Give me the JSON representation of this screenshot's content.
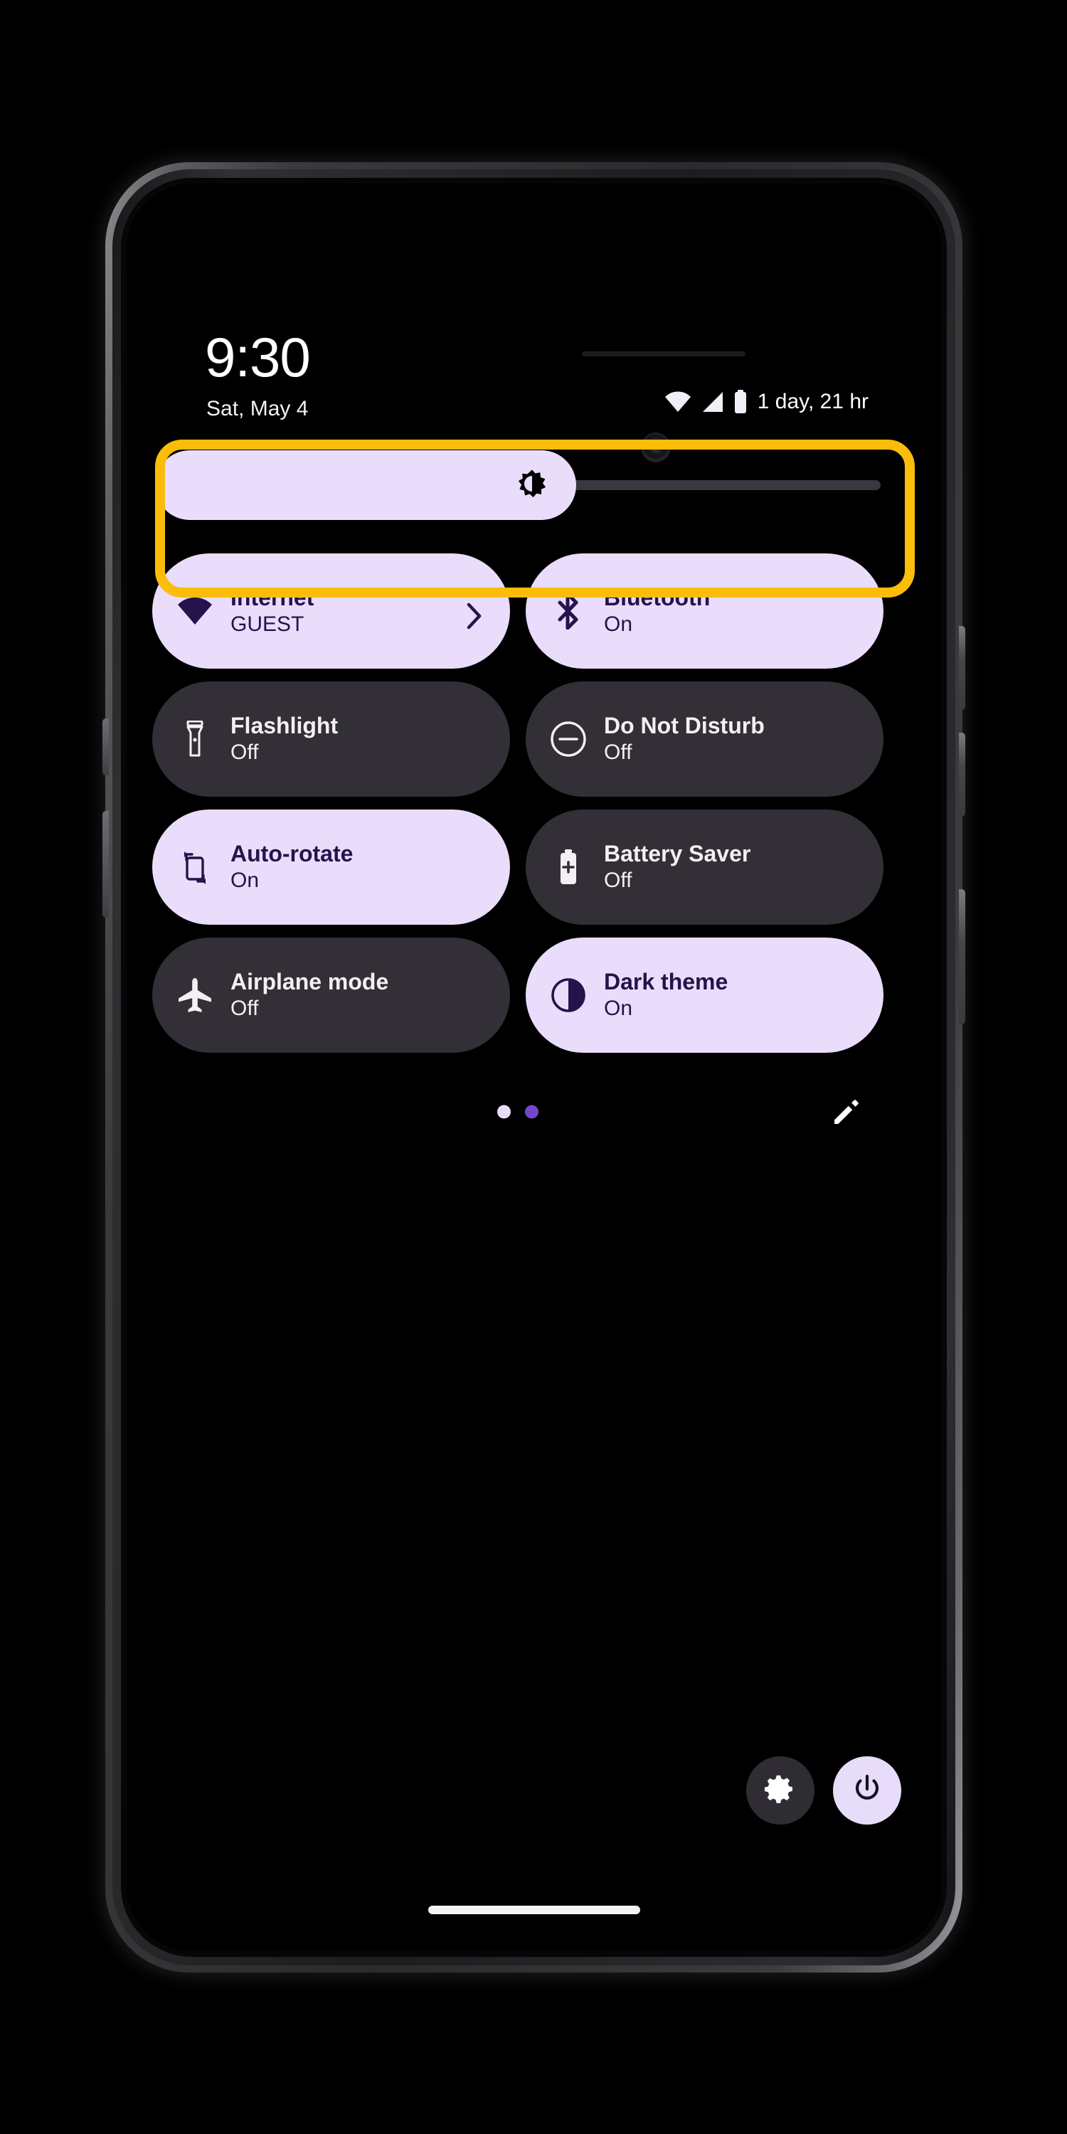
{
  "statusbar": {
    "clock": "9:30",
    "date": "Sat, May 4",
    "battery_estimate": "1 day, 21 hr",
    "icons": [
      "wifi-icon",
      "cellular-signal-icon",
      "battery-icon"
    ]
  },
  "brightness": {
    "name": "brightness-slider",
    "icon": "brightness-icon",
    "value_percent": 58,
    "fill_color": "#E9DDFB",
    "track_color": "#3A373E"
  },
  "highlight": {
    "target": "brightness-slider",
    "color": "#FBBC0A"
  },
  "tiles": [
    {
      "label": "Internet",
      "state": "GUEST",
      "icon": "wifi-icon",
      "active": true,
      "chevron": true
    },
    {
      "label": "Bluetooth",
      "state": "On",
      "icon": "bluetooth-icon",
      "active": true,
      "chevron": false
    },
    {
      "label": "Flashlight",
      "state": "Off",
      "icon": "flashlight-icon",
      "active": false,
      "chevron": false
    },
    {
      "label": "Do Not Disturb",
      "state": "Off",
      "icon": "do-not-disturb-icon",
      "active": false,
      "chevron": false
    },
    {
      "label": "Auto-rotate",
      "state": "On",
      "icon": "auto-rotate-icon",
      "active": true,
      "chevron": false
    },
    {
      "label": "Battery Saver",
      "state": "Off",
      "icon": "battery-saver-icon",
      "active": false,
      "chevron": false
    },
    {
      "label": "Airplane mode",
      "state": "Off",
      "icon": "airplane-icon",
      "active": false,
      "chevron": false
    },
    {
      "label": "Dark theme",
      "state": "On",
      "icon": "dark-theme-icon",
      "active": true,
      "chevron": false
    }
  ],
  "footer": {
    "pages": [
      {
        "name": "page-dot-1",
        "active": false
      },
      {
        "name": "page-dot-2",
        "active": true
      }
    ],
    "edit_icon": "pencil-edit-icon"
  },
  "bottom_actions": [
    {
      "name": "settings-button",
      "icon": "gear-icon",
      "background": "#2F2C33"
    },
    {
      "name": "power-button",
      "icon": "power-icon",
      "background": "#E7DCFA"
    }
  ],
  "colors": {
    "active_tile": "#E9DDFB",
    "inactive_tile": "#322F36",
    "active_text": "#24144B",
    "inactive_text": "#F4EFF4",
    "highlight": "#FBBC0A",
    "screen_background": "#000000"
  }
}
